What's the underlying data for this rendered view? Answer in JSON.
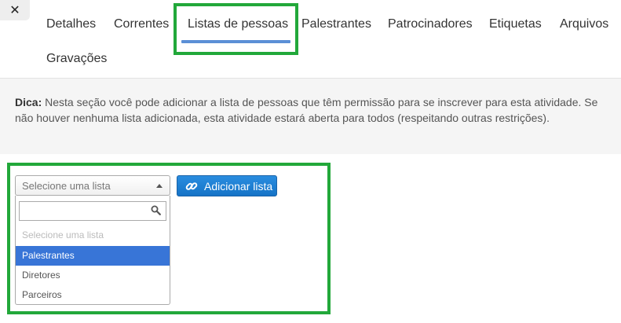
{
  "close_label": "✕",
  "tabs": [
    {
      "label": "Detalhes"
    },
    {
      "label": "Correntes"
    },
    {
      "label": "Listas de pessoas"
    },
    {
      "label": "Palestrantes"
    },
    {
      "label": "Patrocinadores"
    },
    {
      "label": "Etiquetas"
    },
    {
      "label": "Arquivos"
    },
    {
      "label": "Gravações"
    }
  ],
  "active_tab": "Listas de pessoas",
  "tip": {
    "prefix": "Dica:",
    "text": " Nesta seção você pode adicionar a lista de pessoas que têm permissão para se inscrever para esta atividade. Se não houver nenhuma lista adicionada, esta atividade estará aberta para todos (respeitando outras restrições)."
  },
  "list_select": {
    "placeholder": "Selecione uma lista",
    "search_value": "",
    "options": [
      {
        "label": "Selecione uma lista",
        "state": "placeholder"
      },
      {
        "label": "Palestrantes",
        "state": "highlighted"
      },
      {
        "label": "Diretores",
        "state": "normal"
      },
      {
        "label": "Parceiros",
        "state": "normal"
      }
    ]
  },
  "add_button": {
    "label": "Adicionar lista",
    "icon": "link-icon"
  },
  "colors": {
    "highlight_box": "#22a83a",
    "tab_underline": "#5b8fd6",
    "option_highlight": "#3875d7",
    "button": "#1573c7",
    "tip_background": "#f5f5f5"
  }
}
